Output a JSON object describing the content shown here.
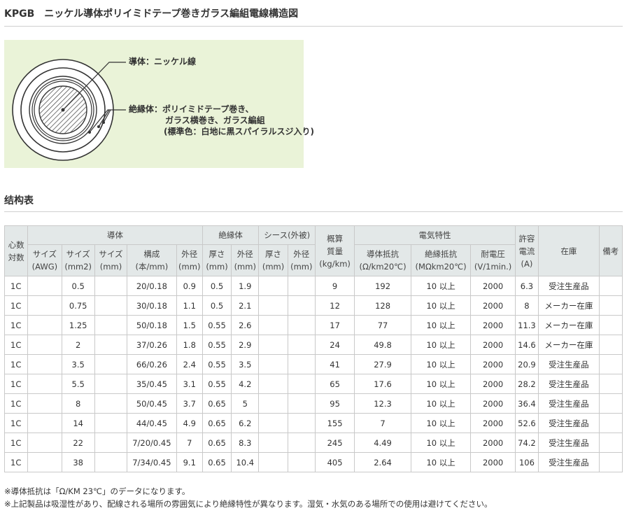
{
  "title": "KPGB　ニッケル導体ポリイミドテープ巻きガラス編組電線構造図",
  "figure": {
    "conductor_label": "導体：ニッケル線",
    "insulation_label": "絶縁体：ポリイミドテープ巻き、",
    "insulation_line2": "ガラス横巻き、ガラス編組",
    "insulation_line3": "(標準色：白地に黒スパイラルスジ入り)"
  },
  "section_title": "结构表",
  "table": {
    "header": {
      "cores": "心数\n対数",
      "conductor": "導体",
      "insulation": "絶縁体",
      "sheath": "シース(外被)",
      "weight": "概算\n質量\n(kg/km)",
      "electrical": "電気特性",
      "current": "許容\n電流\n(A)",
      "stock": "在庫",
      "remarks": "備考",
      "size_awg": "サイズ\n(AWG)",
      "size_mm2": "サイズ\n(mm2)",
      "size_mm": "サイズ\n(mm)",
      "composition": "構成\n(本/mm)",
      "cond_od": "外径\n(mm)",
      "ins_thick": "厚さ\n(mm)",
      "ins_od": "外径\n(mm)",
      "sh_thick": "厚さ\n(mm)",
      "sh_od": "外径\n(mm)",
      "resistance": "導体抵抗\n(Ω/km20℃)",
      "ins_resistance": "絶縁抵抗\n(MΩkm20℃)",
      "voltage": "耐電圧\n(V/1min.)"
    },
    "rows": [
      [
        "1C",
        "",
        "0.5",
        "",
        "20/0.18",
        "0.9",
        "0.5",
        "1.9",
        "",
        "",
        "9",
        "192",
        "10 以上",
        "2000",
        "6.3",
        "受注生産品",
        ""
      ],
      [
        "1C",
        "",
        "0.75",
        "",
        "30/0.18",
        "1.1",
        "0.5",
        "2.1",
        "",
        "",
        "12",
        "128",
        "10 以上",
        "2000",
        "8",
        "メーカー在庫",
        ""
      ],
      [
        "1C",
        "",
        "1.25",
        "",
        "50/0.18",
        "1.5",
        "0.55",
        "2.6",
        "",
        "",
        "17",
        "77",
        "10 以上",
        "2000",
        "11.3",
        "メーカー在庫",
        ""
      ],
      [
        "1C",
        "",
        "2",
        "",
        "37/0.26",
        "1.8",
        "0.55",
        "2.9",
        "",
        "",
        "24",
        "49.8",
        "10 以上",
        "2000",
        "14.6",
        "メーカー在庫",
        ""
      ],
      [
        "1C",
        "",
        "3.5",
        "",
        "66/0.26",
        "2.4",
        "0.55",
        "3.5",
        "",
        "",
        "41",
        "27.9",
        "10 以上",
        "2000",
        "20.9",
        "受注生産品",
        ""
      ],
      [
        "1C",
        "",
        "5.5",
        "",
        "35/0.45",
        "3.1",
        "0.55",
        "4.2",
        "",
        "",
        "65",
        "17.6",
        "10 以上",
        "2000",
        "28.2",
        "受注生産品",
        ""
      ],
      [
        "1C",
        "",
        "8",
        "",
        "50/0.45",
        "3.7",
        "0.65",
        "5",
        "",
        "",
        "95",
        "12.3",
        "10 以上",
        "2000",
        "36.4",
        "受注生産品",
        ""
      ],
      [
        "1C",
        "",
        "14",
        "",
        "44/0.45",
        "4.9",
        "0.65",
        "6.2",
        "",
        "",
        "155",
        "7",
        "10 以上",
        "2000",
        "52.6",
        "受注生産品",
        ""
      ],
      [
        "1C",
        "",
        "22",
        "",
        "7/20/0.45",
        "7",
        "0.65",
        "8.3",
        "",
        "",
        "245",
        "4.49",
        "10 以上",
        "2000",
        "74.2",
        "受注生産品",
        ""
      ],
      [
        "1C",
        "",
        "38",
        "",
        "7/34/0.45",
        "9.1",
        "0.65",
        "10.4",
        "",
        "",
        "405",
        "2.64",
        "10 以上",
        "2000",
        "106",
        "受注生産品",
        ""
      ]
    ]
  },
  "notes": [
    "※導体抵抗は「Ω/KM 23℃」のデータになります。",
    "※上記製品は吸湿性があり、配線される場所の雰囲気により絶縁特性が異なります。湿気・水気のある場所での使用は避けてください。"
  ]
}
